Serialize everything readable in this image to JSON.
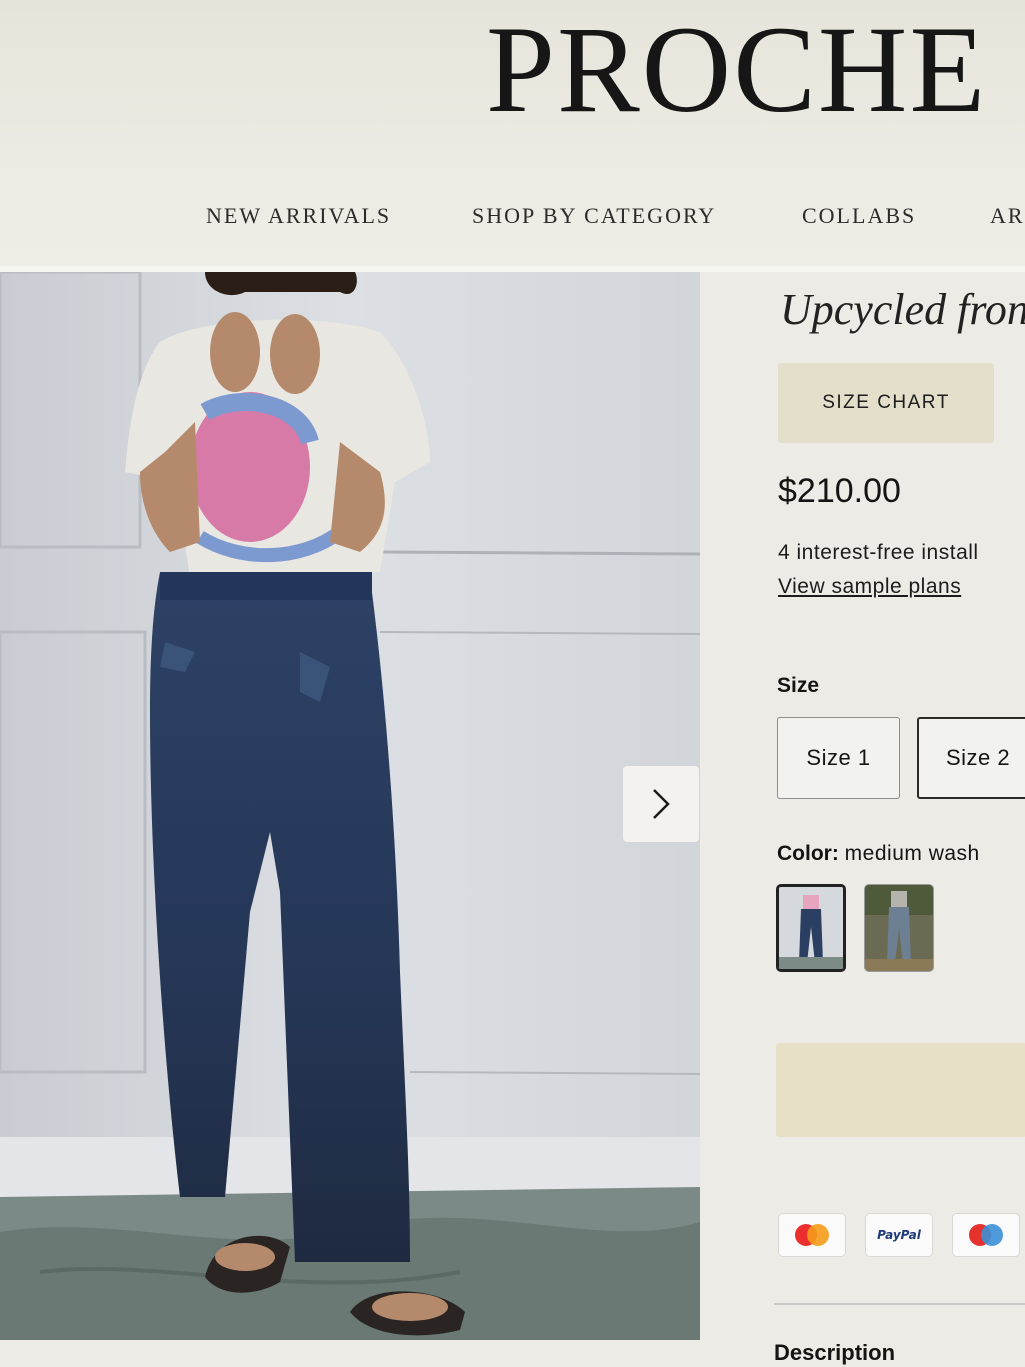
{
  "brand": {
    "logo_text": "PROCHE"
  },
  "nav": {
    "items": [
      {
        "label": "NEW ARRIVALS"
      },
      {
        "label": "SHOP BY CATEGORY"
      },
      {
        "label": "COLLABS"
      },
      {
        "label": "AR"
      }
    ]
  },
  "gallery": {
    "next_icon": "chevron-right-icon"
  },
  "product": {
    "title": "Upcycled fron",
    "size_chart_label": "SIZE CHART",
    "price": "$210.00",
    "installments_text": "4 interest-free install",
    "sample_plans_link": "View sample plans",
    "size_label": "Size",
    "sizes": [
      {
        "label": "Size 1"
      },
      {
        "label": "Size 2"
      }
    ],
    "color_label": "Color:",
    "color_value": "medium wash",
    "add_to_cart_label": "",
    "description_label": "Description"
  },
  "payment_methods": [
    {
      "name": "mastercard-icon"
    },
    {
      "name": "paypal-icon",
      "text": "PayPal"
    },
    {
      "name": "maestro-icon"
    }
  ],
  "colors": {
    "accent_button": "#e4dfca",
    "text": "#141414"
  }
}
